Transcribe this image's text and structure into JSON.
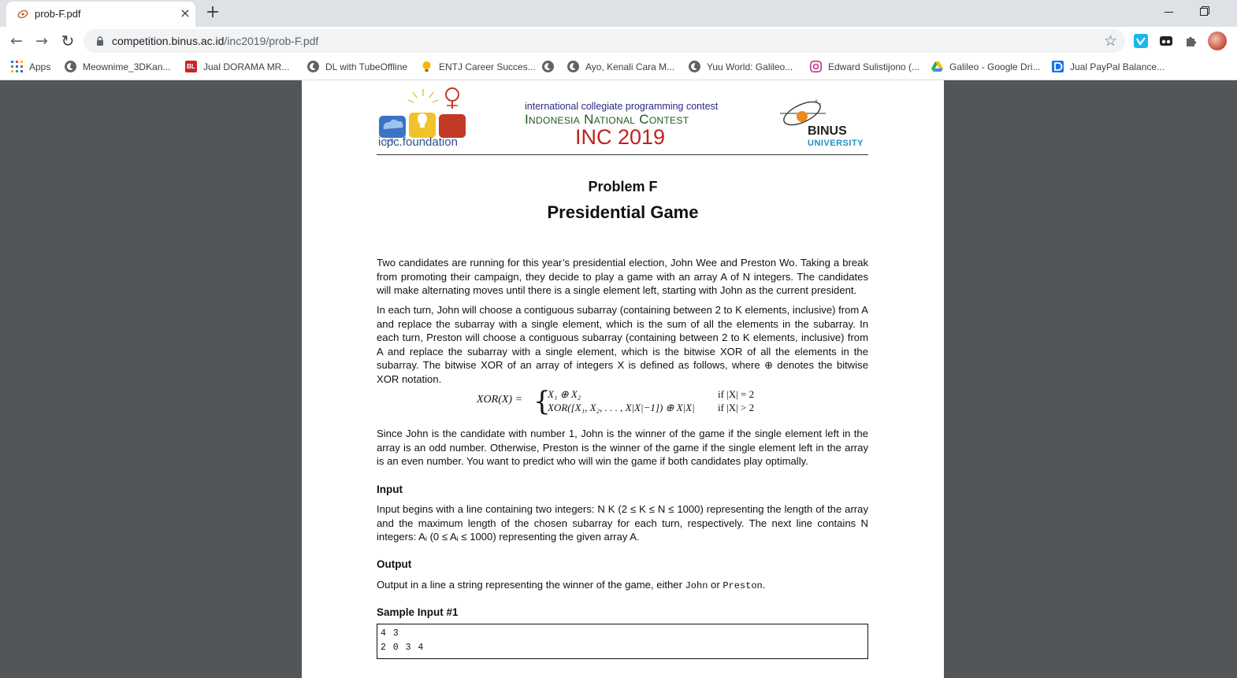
{
  "tab": {
    "title": "prob-F.pdf",
    "close": "×",
    "new_tab": "+"
  },
  "toolbar": {
    "back": "←",
    "forward": "→",
    "reload": "↻",
    "url_host": "competition.binus.ac.id",
    "url_path": "/inc2019/prob-F.pdf",
    "star": "☆"
  },
  "bookmarks": [
    {
      "label": "Apps",
      "icon": "apps-grid-icon"
    },
    {
      "label": "Meownime_3DKan...",
      "icon": "globe-icon"
    },
    {
      "label": "Jual DORAMA MR...",
      "icon": "bl-icon",
      "badge": "BL"
    },
    {
      "label": "DL with TubeOffline",
      "icon": "globe-icon"
    },
    {
      "label": "ENTJ Career Succes...",
      "icon": "bulb-icon"
    },
    {
      "label": "",
      "icon": "globe-icon"
    },
    {
      "label": "Ayo, Kenali Cara M...",
      "icon": "globe-icon"
    },
    {
      "label": "Yuu World: Galileo...",
      "icon": "globe-icon"
    },
    {
      "label": "Edward Sulistijono (...",
      "icon": "instagram-icon"
    },
    {
      "label": "Galileo - Google Dri...",
      "icon": "google-drive-icon"
    },
    {
      "label": "Jual PayPal Balance...",
      "icon": "d-icon"
    }
  ],
  "pdf": {
    "header": {
      "icpc": "icpc.foundation",
      "contest_line1": "international collegiate programming contest",
      "contest_line2": "Indonesia National Contest",
      "contest_main": "INC 2019",
      "binus_name": "BINUS",
      "binus_uni": "UNIVERSITY"
    },
    "problem_label": "Problem F",
    "problem_title": "Presidential Game",
    "para1": "Two candidates are running for this year’s presidential election, John Wee and Preston Wo. Taking a break from promoting their campaign, they decide to play a game with an array A of N integers. The candidates will make alternating moves until there is a single element left, starting with John as the current president.",
    "para2": "In each turn, John will choose a contiguous subarray (containing between 2 to K elements, inclusive) from A and replace the subarray with a single element, which is the sum of all the elements in the subarray. In each turn, Preston will choose a contiguous subarray (containing between 2 to K elements, inclusive) from A and replace the subarray with a single element, which is the bitwise XOR of all the elements in the subarray. The bitwise XOR of an array of integers X is defined as follows, where ⊕ denotes the bitwise XOR notation.",
    "formula": {
      "lhs": "XOR(X) =",
      "case1": "X₁ ⊕ X₂",
      "cond1": "if |X| = 2",
      "case2": "XOR([X₁, X₂, . . . , X|X|−1]) ⊕ X|X|",
      "cond2": "if |X| > 2"
    },
    "para3": "Since John is the candidate with number 1, John is the winner of the game if the single element left in the array is an odd number. Otherwise, Preston is the winner of the game if the single element left in the array is an even number. You want to predict who will win the game if both candidates play optimally.",
    "input_title": "Input",
    "input_text": "Input begins with a line containing two integers: N K (2 ≤ K ≤ N ≤ 1000) representing the length of the array and the maximum length of the chosen subarray for each turn, respectively. The next line contains N integers: Aᵢ (0 ≤ Aᵢ ≤ 1000) representing the given array A.",
    "output_title": "Output",
    "output_pre": "Output in a line a string representing the winner of the game, either ",
    "output_john": "John",
    "output_or": " or ",
    "output_preston": "Preston",
    "output_end": ".",
    "sample_title": "Sample Input #1",
    "sample_lines": [
      "4 3",
      "2 0 3 4"
    ]
  }
}
